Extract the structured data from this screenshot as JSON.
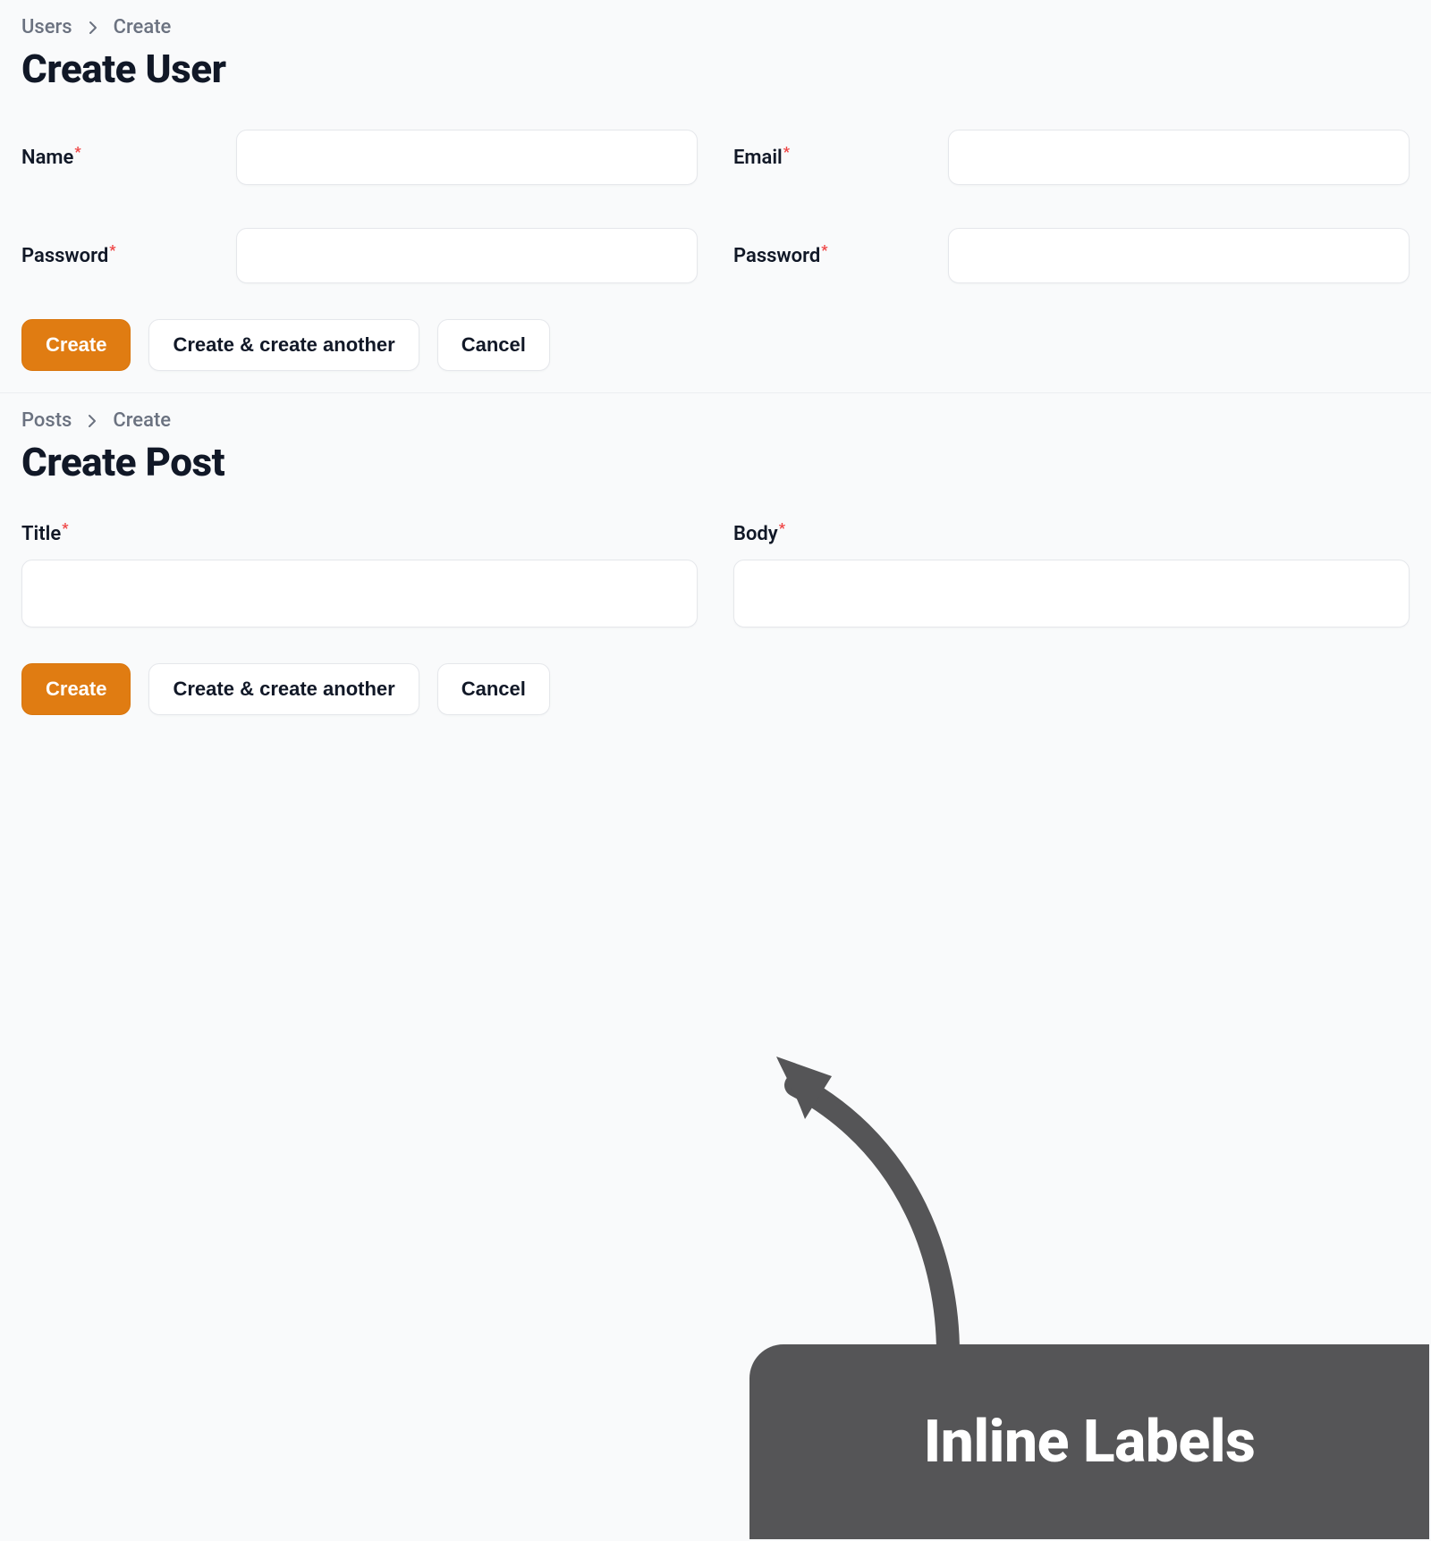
{
  "sections": [
    {
      "breadcrumb": {
        "root": "Users",
        "leaf": "Create"
      },
      "title": "Create User",
      "fields": {
        "name": {
          "label": "Name",
          "required": "*"
        },
        "email": {
          "label": "Email",
          "required": "*"
        },
        "password": {
          "label": "Password",
          "required": "*"
        },
        "password2": {
          "label": "Password",
          "required": "*"
        }
      },
      "actions": {
        "primary": "Create",
        "another": "Create & create another",
        "cancel": "Cancel"
      }
    },
    {
      "breadcrumb": {
        "root": "Posts",
        "leaf": "Create"
      },
      "title": "Create Post",
      "fields": {
        "title": {
          "label": "Title",
          "required": "*"
        },
        "body": {
          "label": "Body",
          "required": "*"
        }
      },
      "actions": {
        "primary": "Create",
        "another": "Create & create another",
        "cancel": "Cancel"
      }
    }
  ],
  "annotation": {
    "label": "Inline Labels"
  }
}
